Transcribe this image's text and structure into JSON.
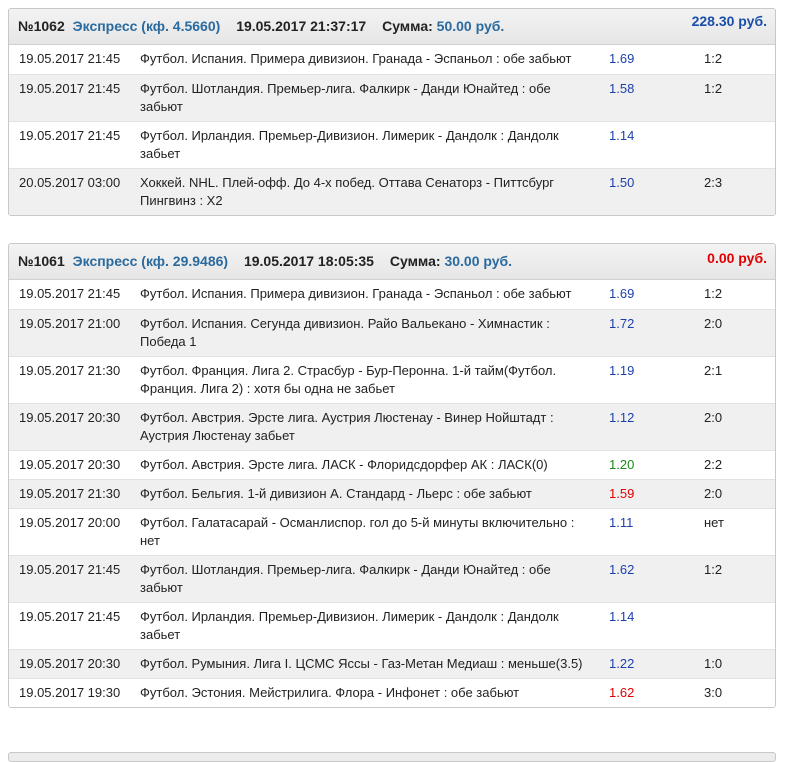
{
  "bets": [
    {
      "number": "№1062",
      "type": "Экспресс (кф. 4.5660)",
      "datetime": "19.05.2017 21:37:17",
      "sum_label": "Сумма:",
      "sum_value": "50.00 руб.",
      "winnings": "228.30 руб.",
      "winnings_color": "#1a4fa8",
      "rows": [
        {
          "date": "19.05.2017 21:45",
          "event": "Футбол. Испания. Примера дивизион. Гранада - Эспаньол : обе забьют",
          "odd": "1.69",
          "odd_color": "blue",
          "result": "1:2"
        },
        {
          "date": "19.05.2017 21:45",
          "event": "Футбол. Шотландия. Премьер-лига. Фалкирк - Данди Юнайтед : обе забьют",
          "odd": "1.58",
          "odd_color": "blue",
          "result": "1:2"
        },
        {
          "date": "19.05.2017 21:45",
          "event": "Футбол. Ирландия. Премьер-Дивизион. Лимерик - Дандолк : Дандолк забьет",
          "odd": "1.14",
          "odd_color": "blue",
          "result": ""
        },
        {
          "date": "20.05.2017 03:00",
          "event": "Хоккей. NHL. Плей-офф. До 4-х побед. Оттава Сенаторз - Питтсбург Пингвинз : Х2",
          "odd": "1.50",
          "odd_color": "blue",
          "result": "2:3"
        }
      ]
    },
    {
      "number": "№1061",
      "type": "Экспресс (кф. 29.9486)",
      "datetime": "19.05.2017 18:05:35",
      "sum_label": "Сумма:",
      "sum_value": "30.00 руб.",
      "winnings": "0.00 руб.",
      "winnings_color": "#e00000",
      "rows": [
        {
          "date": "19.05.2017 21:45",
          "event": "Футбол. Испания. Примера дивизион. Гранада - Эспаньол : обе забьют",
          "odd": "1.69",
          "odd_color": "blue",
          "result": "1:2"
        },
        {
          "date": "19.05.2017 21:00",
          "event": "Футбол. Испания. Сегунда дивизион. Райо Вальекано - Химнастик : Победа 1",
          "odd": "1.72",
          "odd_color": "blue",
          "result": "2:0"
        },
        {
          "date": "19.05.2017 21:30",
          "event": "Футбол. Франция. Лига 2. Страсбур - Бур-Перонна. 1-й тайм(Футбол. Франция. Лига 2) : хотя бы одна не забьет",
          "odd": "1.19",
          "odd_color": "blue",
          "result": "2:1"
        },
        {
          "date": "19.05.2017 20:30",
          "event": "Футбол. Австрия. Эрсте лига. Аустрия Люстенау - Винер Нойштадт : Аустрия Люстенау забьет",
          "odd": "1.12",
          "odd_color": "blue",
          "result": "2:0"
        },
        {
          "date": "19.05.2017 20:30",
          "event": "Футбол. Австрия. Эрсте лига. ЛАСК - Флоридсдорфер АК : ЛАСК(0)",
          "odd": "1.20",
          "odd_color": "green",
          "result": "2:2"
        },
        {
          "date": "19.05.2017 21:30",
          "event": "Футбол. Бельгия. 1-й дивизион А. Стандард - Льерс : обе забьют",
          "odd": "1.59",
          "odd_color": "red",
          "result": "2:0"
        },
        {
          "date": "19.05.2017 20:00",
          "event": "Футбол. Галатасарай - Османлиспор. гол до 5-й минуты включительно : нет",
          "odd": "1.11",
          "odd_color": "blue",
          "result": "нет"
        },
        {
          "date": "19.05.2017 21:45",
          "event": "Футбол. Шотландия. Премьер-лига. Фалкирк - Данди Юнайтед : обе забьют",
          "odd": "1.62",
          "odd_color": "blue",
          "result": "1:2"
        },
        {
          "date": "19.05.2017 21:45",
          "event": "Футбол. Ирландия. Премьер-Дивизион. Лимерик - Дандолк : Дандолк забьет",
          "odd": "1.14",
          "odd_color": "blue",
          "result": ""
        },
        {
          "date": "19.05.2017 20:30",
          "event": "Футбол. Румыния. Лига I. ЦСМС Яссы - Газ-Метан Медиаш : меньше(3.5)",
          "odd": "1.22",
          "odd_color": "blue",
          "result": "1:0"
        },
        {
          "date": "19.05.2017 19:30",
          "event": "Футбол. Эстония. Мейстрилига. Флора - Инфонет : обе забьют",
          "odd": "1.62",
          "odd_color": "red",
          "result": "3:0"
        }
      ]
    }
  ]
}
